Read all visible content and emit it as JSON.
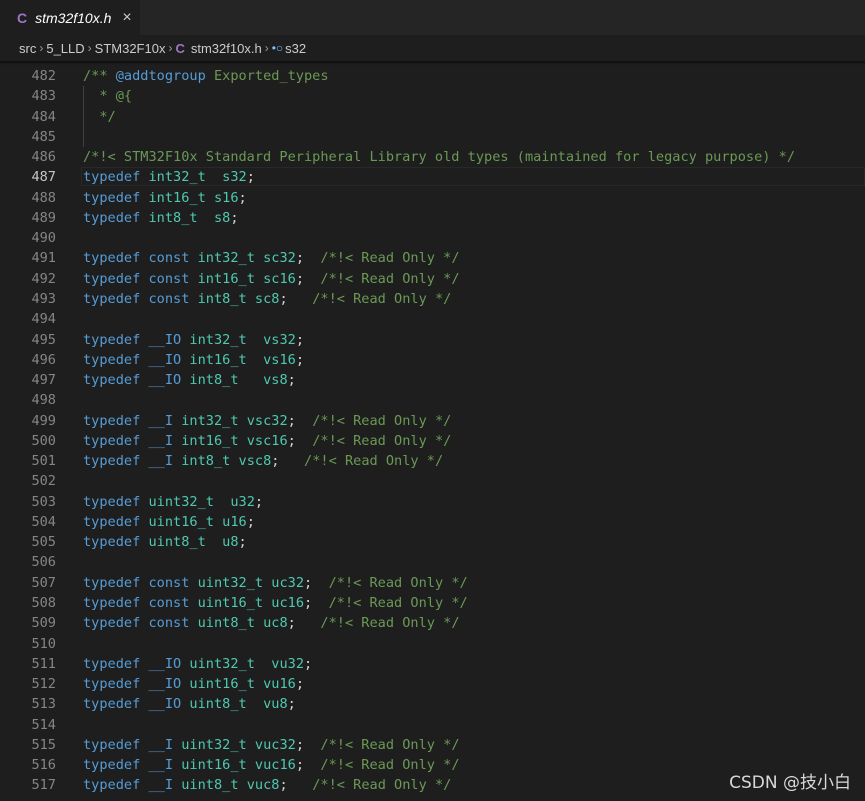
{
  "tab": {
    "icon": "C",
    "title": "stm32f10x.h",
    "close": "×"
  },
  "breadcrumb": {
    "segments": [
      "src",
      "5_LLD",
      "STM32F10x"
    ],
    "file_icon": "C",
    "file": "stm32f10x.h",
    "symbol_icon": "•○",
    "symbol": "s32",
    "separator": "›"
  },
  "watermark": "CSDN @技小白",
  "lines": [
    {
      "n": "482",
      "t": [
        [
          "/** ",
          "cm"
        ],
        [
          "@addtogroup",
          "cmtag"
        ],
        [
          " Exported_types",
          "cm"
        ]
      ]
    },
    {
      "n": "483",
      "t": [
        [
          "  * @{",
          "cm"
        ]
      ]
    },
    {
      "n": "484",
      "t": [
        [
          "  */",
          "cm"
        ]
      ]
    },
    {
      "n": "485",
      "t": []
    },
    {
      "n": "486",
      "t": [
        [
          "/*!< STM32F10x Standard Peripheral Library old types (maintained for legacy purpose) */",
          "cm"
        ]
      ]
    },
    {
      "n": "487",
      "t": [
        [
          "typedef",
          "kw"
        ],
        [
          " ",
          "tx"
        ],
        [
          "int32_t",
          "ty"
        ],
        [
          "  ",
          "tx"
        ],
        [
          "s32",
          "ty"
        ],
        [
          ";",
          "tx"
        ]
      ],
      "active": true
    },
    {
      "n": "488",
      "t": [
        [
          "typedef",
          "kw"
        ],
        [
          " ",
          "tx"
        ],
        [
          "int16_t",
          "ty"
        ],
        [
          " ",
          "tx"
        ],
        [
          "s16",
          "ty"
        ],
        [
          ";",
          "tx"
        ]
      ]
    },
    {
      "n": "489",
      "t": [
        [
          "typedef",
          "kw"
        ],
        [
          " ",
          "tx"
        ],
        [
          "int8_t",
          "ty"
        ],
        [
          "  ",
          "tx"
        ],
        [
          "s8",
          "ty"
        ],
        [
          ";",
          "tx"
        ]
      ]
    },
    {
      "n": "490",
      "t": []
    },
    {
      "n": "491",
      "t": [
        [
          "typedef",
          "kw"
        ],
        [
          " ",
          "tx"
        ],
        [
          "const",
          "kw"
        ],
        [
          " ",
          "tx"
        ],
        [
          "int32_t",
          "ty"
        ],
        [
          " ",
          "tx"
        ],
        [
          "sc32",
          "ty"
        ],
        [
          ";  ",
          "tx"
        ],
        [
          "/*!< Read Only */",
          "cm"
        ]
      ]
    },
    {
      "n": "492",
      "t": [
        [
          "typedef",
          "kw"
        ],
        [
          " ",
          "tx"
        ],
        [
          "const",
          "kw"
        ],
        [
          " ",
          "tx"
        ],
        [
          "int16_t",
          "ty"
        ],
        [
          " ",
          "tx"
        ],
        [
          "sc16",
          "ty"
        ],
        [
          ";  ",
          "tx"
        ],
        [
          "/*!< Read Only */",
          "cm"
        ]
      ]
    },
    {
      "n": "493",
      "t": [
        [
          "typedef",
          "kw"
        ],
        [
          " ",
          "tx"
        ],
        [
          "const",
          "kw"
        ],
        [
          " ",
          "tx"
        ],
        [
          "int8_t",
          "ty"
        ],
        [
          " ",
          "tx"
        ],
        [
          "sc8",
          "ty"
        ],
        [
          ";   ",
          "tx"
        ],
        [
          "/*!< Read Only */",
          "cm"
        ]
      ]
    },
    {
      "n": "494",
      "t": []
    },
    {
      "n": "495",
      "t": [
        [
          "typedef",
          "kw"
        ],
        [
          " ",
          "tx"
        ],
        [
          "__IO",
          "kw"
        ],
        [
          " ",
          "tx"
        ],
        [
          "int32_t",
          "ty"
        ],
        [
          "  ",
          "tx"
        ],
        [
          "vs32",
          "ty"
        ],
        [
          ";",
          "tx"
        ]
      ]
    },
    {
      "n": "496",
      "t": [
        [
          "typedef",
          "kw"
        ],
        [
          " ",
          "tx"
        ],
        [
          "__IO",
          "kw"
        ],
        [
          " ",
          "tx"
        ],
        [
          "int16_t",
          "ty"
        ],
        [
          "  ",
          "tx"
        ],
        [
          "vs16",
          "ty"
        ],
        [
          ";",
          "tx"
        ]
      ]
    },
    {
      "n": "497",
      "t": [
        [
          "typedef",
          "kw"
        ],
        [
          " ",
          "tx"
        ],
        [
          "__IO",
          "kw"
        ],
        [
          " ",
          "tx"
        ],
        [
          "int8_t",
          "ty"
        ],
        [
          "   ",
          "tx"
        ],
        [
          "vs8",
          "ty"
        ],
        [
          ";",
          "tx"
        ]
      ]
    },
    {
      "n": "498",
      "t": []
    },
    {
      "n": "499",
      "t": [
        [
          "typedef",
          "kw"
        ],
        [
          " ",
          "tx"
        ],
        [
          "__I",
          "kw"
        ],
        [
          " ",
          "tx"
        ],
        [
          "int32_t",
          "ty"
        ],
        [
          " ",
          "tx"
        ],
        [
          "vsc32",
          "ty"
        ],
        [
          ";  ",
          "tx"
        ],
        [
          "/*!< Read Only */",
          "cm"
        ]
      ]
    },
    {
      "n": "500",
      "t": [
        [
          "typedef",
          "kw"
        ],
        [
          " ",
          "tx"
        ],
        [
          "__I",
          "kw"
        ],
        [
          " ",
          "tx"
        ],
        [
          "int16_t",
          "ty"
        ],
        [
          " ",
          "tx"
        ],
        [
          "vsc16",
          "ty"
        ],
        [
          ";  ",
          "tx"
        ],
        [
          "/*!< Read Only */",
          "cm"
        ]
      ]
    },
    {
      "n": "501",
      "t": [
        [
          "typedef",
          "kw"
        ],
        [
          " ",
          "tx"
        ],
        [
          "__I",
          "kw"
        ],
        [
          " ",
          "tx"
        ],
        [
          "int8_t",
          "ty"
        ],
        [
          " ",
          "tx"
        ],
        [
          "vsc8",
          "ty"
        ],
        [
          ";   ",
          "tx"
        ],
        [
          "/*!< Read Only */",
          "cm"
        ]
      ]
    },
    {
      "n": "502",
      "t": []
    },
    {
      "n": "503",
      "t": [
        [
          "typedef",
          "kw"
        ],
        [
          " ",
          "tx"
        ],
        [
          "uint32_t",
          "ty"
        ],
        [
          "  ",
          "tx"
        ],
        [
          "u32",
          "ty"
        ],
        [
          ";",
          "tx"
        ]
      ]
    },
    {
      "n": "504",
      "t": [
        [
          "typedef",
          "kw"
        ],
        [
          " ",
          "tx"
        ],
        [
          "uint16_t",
          "ty"
        ],
        [
          " ",
          "tx"
        ],
        [
          "u16",
          "ty"
        ],
        [
          ";",
          "tx"
        ]
      ]
    },
    {
      "n": "505",
      "t": [
        [
          "typedef",
          "kw"
        ],
        [
          " ",
          "tx"
        ],
        [
          "uint8_t",
          "ty"
        ],
        [
          "  ",
          "tx"
        ],
        [
          "u8",
          "ty"
        ],
        [
          ";",
          "tx"
        ]
      ]
    },
    {
      "n": "506",
      "t": []
    },
    {
      "n": "507",
      "t": [
        [
          "typedef",
          "kw"
        ],
        [
          " ",
          "tx"
        ],
        [
          "const",
          "kw"
        ],
        [
          " ",
          "tx"
        ],
        [
          "uint32_t",
          "ty"
        ],
        [
          " ",
          "tx"
        ],
        [
          "uc32",
          "ty"
        ],
        [
          ";  ",
          "tx"
        ],
        [
          "/*!< Read Only */",
          "cm"
        ]
      ]
    },
    {
      "n": "508",
      "t": [
        [
          "typedef",
          "kw"
        ],
        [
          " ",
          "tx"
        ],
        [
          "const",
          "kw"
        ],
        [
          " ",
          "tx"
        ],
        [
          "uint16_t",
          "ty"
        ],
        [
          " ",
          "tx"
        ],
        [
          "uc16",
          "ty"
        ],
        [
          ";  ",
          "tx"
        ],
        [
          "/*!< Read Only */",
          "cm"
        ]
      ]
    },
    {
      "n": "509",
      "t": [
        [
          "typedef",
          "kw"
        ],
        [
          " ",
          "tx"
        ],
        [
          "const",
          "kw"
        ],
        [
          " ",
          "tx"
        ],
        [
          "uint8_t",
          "ty"
        ],
        [
          " ",
          "tx"
        ],
        [
          "uc8",
          "ty"
        ],
        [
          ";   ",
          "tx"
        ],
        [
          "/*!< Read Only */",
          "cm"
        ]
      ]
    },
    {
      "n": "510",
      "t": []
    },
    {
      "n": "511",
      "t": [
        [
          "typedef",
          "kw"
        ],
        [
          " ",
          "tx"
        ],
        [
          "__IO",
          "kw"
        ],
        [
          " ",
          "tx"
        ],
        [
          "uint32_t",
          "ty"
        ],
        [
          "  ",
          "tx"
        ],
        [
          "vu32",
          "ty"
        ],
        [
          ";",
          "tx"
        ]
      ]
    },
    {
      "n": "512",
      "t": [
        [
          "typedef",
          "kw"
        ],
        [
          " ",
          "tx"
        ],
        [
          "__IO",
          "kw"
        ],
        [
          " ",
          "tx"
        ],
        [
          "uint16_t",
          "ty"
        ],
        [
          " ",
          "tx"
        ],
        [
          "vu16",
          "ty"
        ],
        [
          ";",
          "tx"
        ]
      ]
    },
    {
      "n": "513",
      "t": [
        [
          "typedef",
          "kw"
        ],
        [
          " ",
          "tx"
        ],
        [
          "__IO",
          "kw"
        ],
        [
          " ",
          "tx"
        ],
        [
          "uint8_t",
          "ty"
        ],
        [
          "  ",
          "tx"
        ],
        [
          "vu8",
          "ty"
        ],
        [
          ";",
          "tx"
        ]
      ]
    },
    {
      "n": "514",
      "t": []
    },
    {
      "n": "515",
      "t": [
        [
          "typedef",
          "kw"
        ],
        [
          " ",
          "tx"
        ],
        [
          "__I",
          "kw"
        ],
        [
          " ",
          "tx"
        ],
        [
          "uint32_t",
          "ty"
        ],
        [
          " ",
          "tx"
        ],
        [
          "vuc32",
          "ty"
        ],
        [
          ";  ",
          "tx"
        ],
        [
          "/*!< Read Only */",
          "cm"
        ]
      ]
    },
    {
      "n": "516",
      "t": [
        [
          "typedef",
          "kw"
        ],
        [
          " ",
          "tx"
        ],
        [
          "__I",
          "kw"
        ],
        [
          " ",
          "tx"
        ],
        [
          "uint16_t",
          "ty"
        ],
        [
          " ",
          "tx"
        ],
        [
          "vuc16",
          "ty"
        ],
        [
          ";  ",
          "tx"
        ],
        [
          "/*!< Read Only */",
          "cm"
        ]
      ]
    },
    {
      "n": "517",
      "t": [
        [
          "typedef",
          "kw"
        ],
        [
          " ",
          "tx"
        ],
        [
          "__I",
          "kw"
        ],
        [
          " ",
          "tx"
        ],
        [
          "uint8_t",
          "ty"
        ],
        [
          " ",
          "tx"
        ],
        [
          "vuc8",
          "ty"
        ],
        [
          ";   ",
          "tx"
        ],
        [
          "/*!< Read Only */",
          "cm"
        ]
      ]
    }
  ]
}
